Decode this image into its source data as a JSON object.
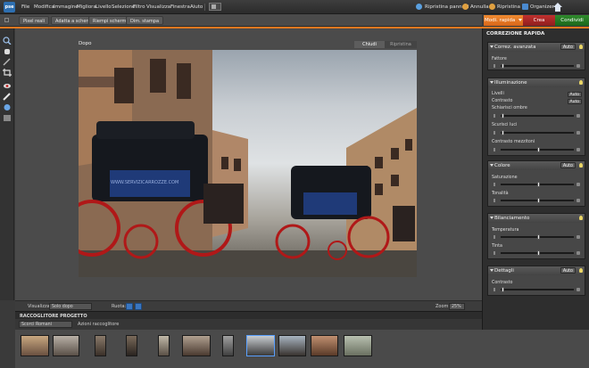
{
  "app": {
    "logo_text": "pse"
  },
  "menu": [
    "File",
    "Modifica",
    "Immagine",
    "Migliora",
    "Livello",
    "Selezione",
    "Filtro",
    "Visualizza",
    "Finestra",
    "Aiuto"
  ],
  "top_actions": {
    "repair": "Ripristina pannelli",
    "undo": "Annulla",
    "redo": "Ripristina",
    "organizer": "Organizer"
  },
  "options_bar": [
    "Pixel reali",
    "Adatta a schermo",
    "Riempi schermo",
    "Dim. stampa"
  ],
  "tabs": {
    "edit": "Modi. rapida",
    "create": "Crea",
    "share": "Condividi"
  },
  "document": {
    "label": "Dopo",
    "view_before": "Chiudi",
    "view_after": "Ripristina"
  },
  "view_bar": {
    "view_label": "Visualizza:",
    "view_value": "Solo dopo",
    "rotate_label": "Ruota:",
    "zoom_label": "Zoom:",
    "zoom_value": "25%"
  },
  "project_bin": {
    "title": "RACCOGLITORE PROGETTO",
    "source": "Scorci Romani",
    "actions": "Azioni raccoglitore"
  },
  "photo": {
    "watermark": "WWW.SERVIZICARROZZE.COM"
  },
  "panel": {
    "title": "CORREZIONE RAPIDA",
    "sections": {
      "smart": {
        "title": "Correz. avanzata",
        "auto": "Auto",
        "param": "Fattore"
      },
      "lighting": {
        "title": "Illuminazione",
        "levels": "Livelli",
        "levels_auto": "Auto",
        "contrast": "Contrasto",
        "contrast_auto": "Auto",
        "shadows": "Schiarisci ombre",
        "highlights": "Scurisci luci",
        "midtones": "Contrasto mezzitoni"
      },
      "color": {
        "title": "Colore",
        "auto": "Auto",
        "saturation": "Saturazione",
        "hue": "Tonalità"
      },
      "balance": {
        "title": "Bilanciamento",
        "temperature": "Temperatura",
        "tint": "Tinta"
      },
      "details": {
        "title": "Dettagli",
        "auto": "Auto",
        "sharpen": "Contrasto"
      }
    }
  },
  "colors": {
    "accent": "#e07820",
    "edit_tab": "#e9781f",
    "create_tab": "#b02a2a",
    "share_tab": "#2a7f28",
    "bulb": "#e9d566"
  }
}
